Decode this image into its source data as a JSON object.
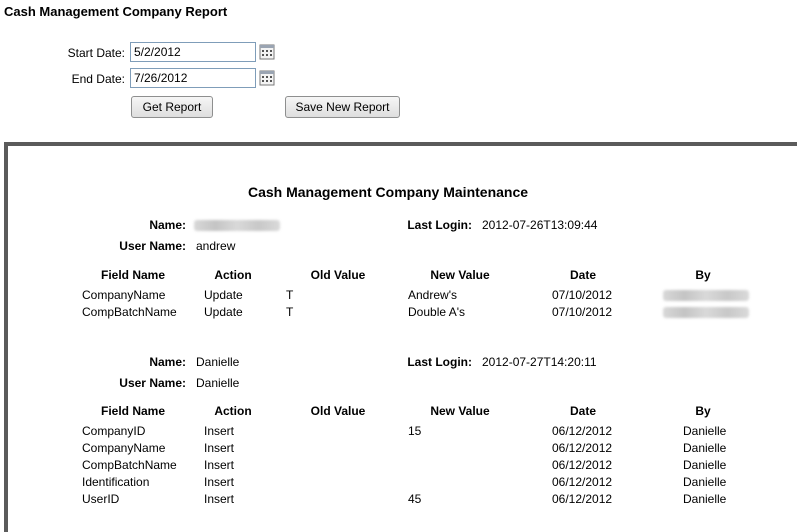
{
  "page_title": "Cash Management Company Report",
  "form": {
    "start_label": "Start Date:",
    "start_value": "5/2/2012",
    "end_label": "End Date:",
    "end_value": "7/26/2012",
    "get_report": "Get Report",
    "save_report": "Save New Report"
  },
  "report": {
    "title": "Cash Management Company Maintenance",
    "labels": {
      "name": "Name:",
      "user_name": "User Name:",
      "last_login": "Last Login:"
    },
    "columns": [
      "Field Name",
      "Action",
      "Old Value",
      "New Value",
      "Date",
      "By"
    ],
    "sections": [
      {
        "name": "",
        "user_name": "andrew",
        "last_login": "2012-07-26T13:09:44",
        "rows": [
          {
            "field": "CompanyName",
            "action": "Update",
            "old": "T",
            "new": "Andrew's",
            "date": "07/10/2012",
            "by": ""
          },
          {
            "field": "CompBatchName",
            "action": "Update",
            "old": "T",
            "new": "Double A's",
            "date": "07/10/2012",
            "by": ""
          }
        ]
      },
      {
        "name": "Danielle",
        "user_name": "Danielle",
        "last_login": "2012-07-27T14:20:11",
        "rows": [
          {
            "field": "CompanyID",
            "action": "Insert",
            "old": "",
            "new": "15",
            "date": "06/12/2012",
            "by": "Danielle"
          },
          {
            "field": "CompanyName",
            "action": "Insert",
            "old": "",
            "new": "",
            "date": "06/12/2012",
            "by": "Danielle"
          },
          {
            "field": "CompBatchName",
            "action": "Insert",
            "old": "",
            "new": "",
            "date": "06/12/2012",
            "by": "Danielle"
          },
          {
            "field": "Identification",
            "action": "Insert",
            "old": "",
            "new": "",
            "date": "06/12/2012",
            "by": "Danielle"
          },
          {
            "field": "UserID",
            "action": "Insert",
            "old": "",
            "new": "45",
            "date": "06/12/2012",
            "by": "Danielle"
          }
        ]
      }
    ]
  }
}
